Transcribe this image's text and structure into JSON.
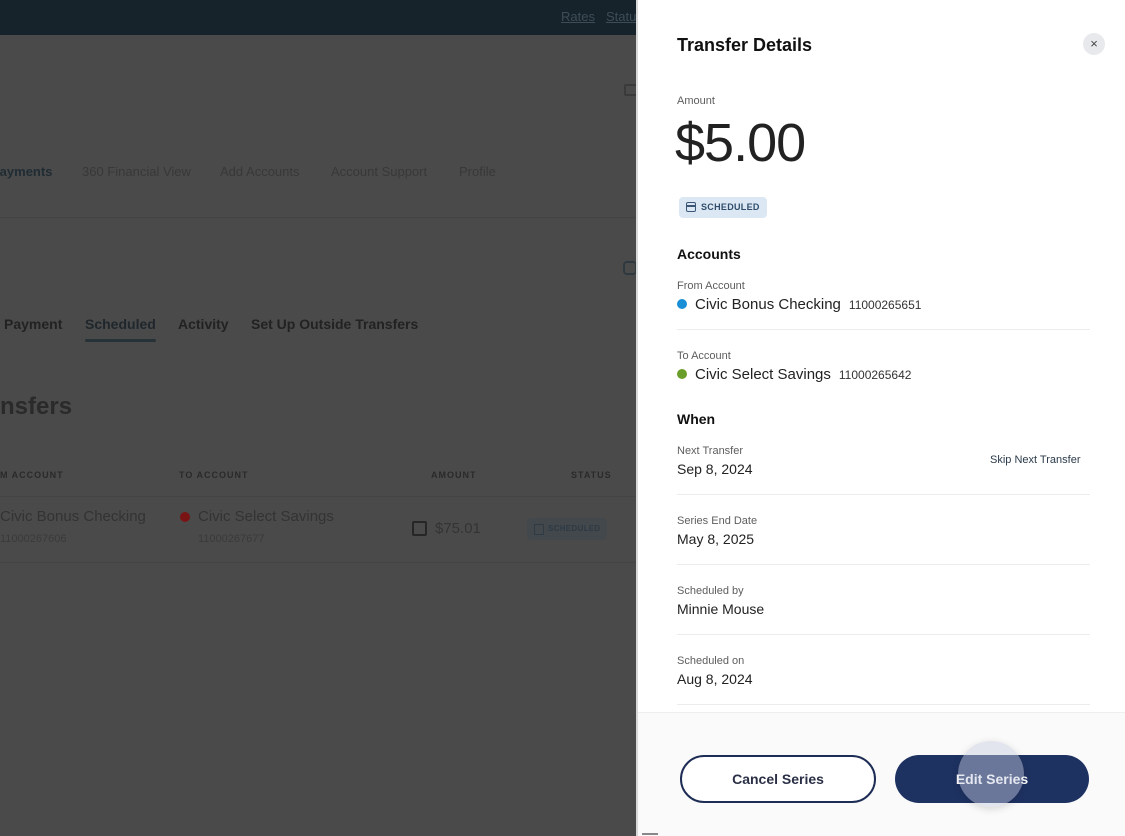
{
  "background": {
    "topbar": {
      "links": [
        "Rates",
        "Status"
      ]
    },
    "main_nav": {
      "items": [
        "Payments",
        "360 Financial View",
        "Add Accounts",
        "Account Support",
        "Profile"
      ],
      "active": "Payments"
    },
    "sub_tabs": {
      "items": [
        "Payment",
        "Scheduled",
        "Activity",
        "Set Up Outside Transfers"
      ],
      "active": "Scheduled"
    },
    "page_heading": "nsfers",
    "table": {
      "headers": [
        "M ACCOUNT",
        "TO ACCOUNT",
        "AMOUNT",
        "STATUS"
      ],
      "rows": [
        {
          "from_name": "Civic Bonus Checking",
          "from_number": "11000267606",
          "to_name": "Civic Select Savings",
          "to_number": "11000267677",
          "amount": "$75.01",
          "status": "SCHEDULED"
        }
      ]
    }
  },
  "drawer": {
    "title": "Transfer Details",
    "close_icon": "×",
    "amount_label": "Amount",
    "amount_value": "$5.00",
    "status_badge": "SCHEDULED",
    "accounts_section": "Accounts",
    "from_label": "From Account",
    "from_name": "Civic Bonus Checking",
    "from_number": "11000265651",
    "from_color": "#1a8fd6",
    "to_label": "To Account",
    "to_name": "Civic Select Savings",
    "to_number": "11000265642",
    "to_color": "#6a9e2a",
    "when_section": "When",
    "next_transfer_label": "Next Transfer",
    "next_transfer_value": "Sep 8, 2024",
    "skip_link": "Skip Next Transfer",
    "series_end_label": "Series End Date",
    "series_end_value": "May 8, 2025",
    "scheduled_by_label": "Scheduled by",
    "scheduled_by_value": "Minnie Mouse",
    "scheduled_on_label": "Scheduled on",
    "scheduled_on_value": "Aug 8, 2024",
    "buttons": {
      "cancel": "Cancel Series",
      "edit": "Edit Series"
    }
  }
}
